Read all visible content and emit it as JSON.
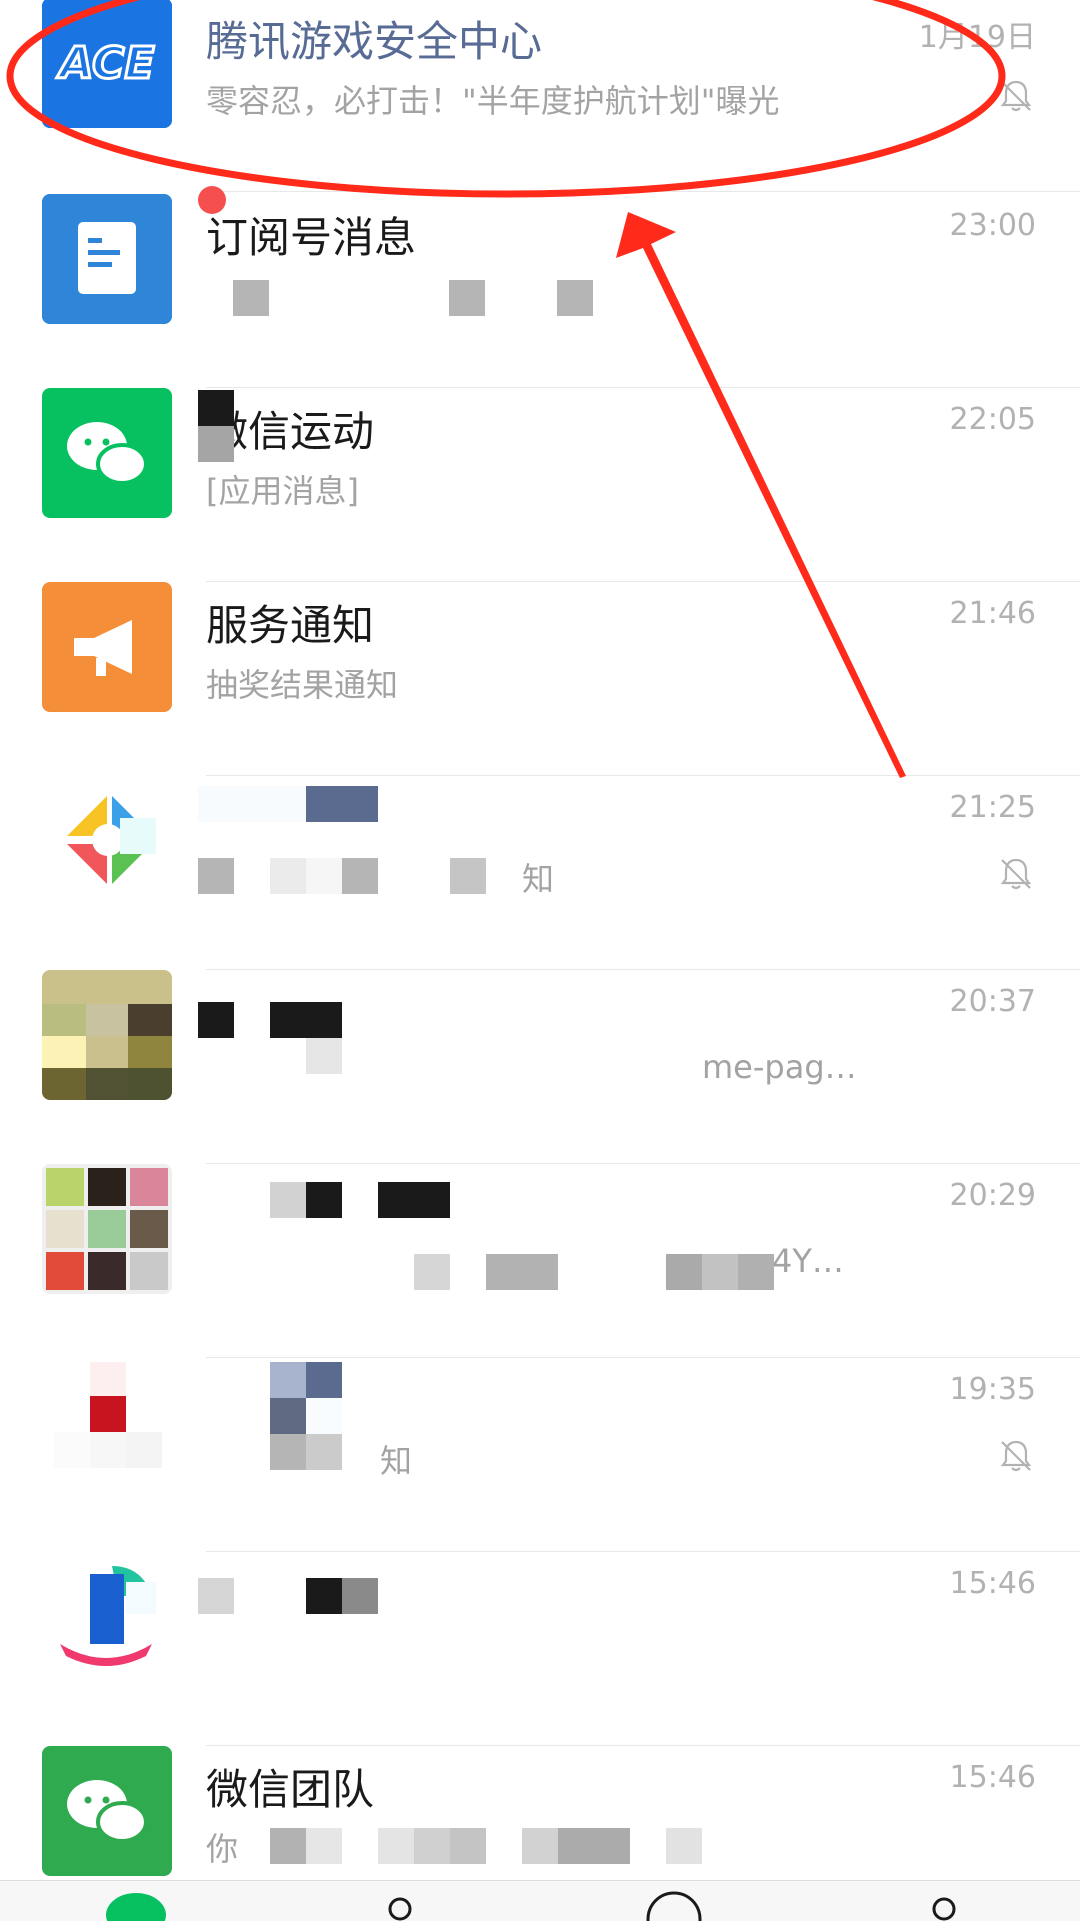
{
  "chats": [
    {
      "title": "腾讯游戏安全中心",
      "preview": "零容忍，必打击！\"半年度护航计划\"曝光",
      "time": "1月19日",
      "muted": true,
      "avatar_text": "ACE"
    },
    {
      "title": "订阅号消息",
      "preview": "",
      "time": "23:00",
      "muted": false,
      "unread_dot": true
    },
    {
      "title": "微信运动",
      "preview": "[应用消息]",
      "time": "22:05",
      "muted": false
    },
    {
      "title": "服务通知",
      "preview": "抽奖结果通知",
      "time": "21:46",
      "muted": false
    },
    {
      "title": "",
      "preview": "知",
      "time": "21:25",
      "muted": true
    },
    {
      "title": "",
      "preview": "me-pag…",
      "time": "20:37",
      "muted": false
    },
    {
      "title": "",
      "preview": "4Y…",
      "time": "20:29",
      "muted": false
    },
    {
      "title": "",
      "preview": "知",
      "time": "19:35",
      "muted": true
    },
    {
      "title": "",
      "preview": "",
      "time": "15:46",
      "muted": false
    },
    {
      "title": "微信团队",
      "preview": "你",
      "time": "15:46",
      "muted": false
    }
  ],
  "tabs": [
    {
      "icon": "chat-icon"
    },
    {
      "icon": "contacts-icon"
    },
    {
      "icon": "discover-icon"
    },
    {
      "icon": "me-icon"
    }
  ],
  "colors": {
    "accent": "#07c160",
    "annotation": "#ff2a1a",
    "muted_icon": "#b2b2b2"
  }
}
